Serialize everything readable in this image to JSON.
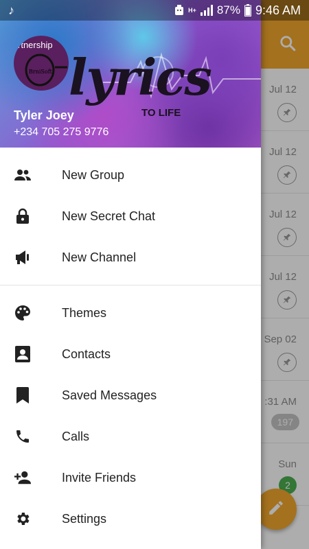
{
  "status_bar": {
    "battery_percent": "87%",
    "time": "9:46 AM",
    "network_label": "H+"
  },
  "drawer": {
    "header": {
      "logo_text": "lyrics",
      "logo_subtext": "TO LIFE",
      "avatar_text": "rtnership",
      "avatar_brand": "BrniSoft",
      "user_name": "Tyler Joey",
      "user_phone": "+234 705 275 9776"
    },
    "menu": [
      {
        "label": "New Group",
        "icon": "group-icon"
      },
      {
        "label": "New Secret Chat",
        "icon": "lock-icon"
      },
      {
        "label": "New Channel",
        "icon": "megaphone-icon"
      },
      {
        "label": "Themes",
        "icon": "palette-icon"
      },
      {
        "label": "Contacts",
        "icon": "contact-icon"
      },
      {
        "label": "Saved Messages",
        "icon": "bookmark-icon"
      },
      {
        "label": "Calls",
        "icon": "phone-icon"
      },
      {
        "label": "Invite Friends",
        "icon": "add-person-icon"
      },
      {
        "label": "Settings",
        "icon": "gear-icon"
      }
    ]
  },
  "chat_list": {
    "rows": [
      {
        "date": "Jul 12",
        "indicator": "pinned"
      },
      {
        "date": "Jul 12",
        "indicator": "pinned"
      },
      {
        "date": "Jul 12",
        "indicator": "pinned"
      },
      {
        "date": "Jul 12",
        "indicator": "pinned"
      },
      {
        "date": "Sep 02",
        "indicator": "pinned"
      },
      {
        "date": ":31 AM",
        "unread": "197"
      },
      {
        "date": "Sun",
        "unread": "2"
      }
    ]
  },
  "colors": {
    "accent": "#f2a72d",
    "badge_green": "#4caf50",
    "badge_gray": "#c5c5c5"
  }
}
